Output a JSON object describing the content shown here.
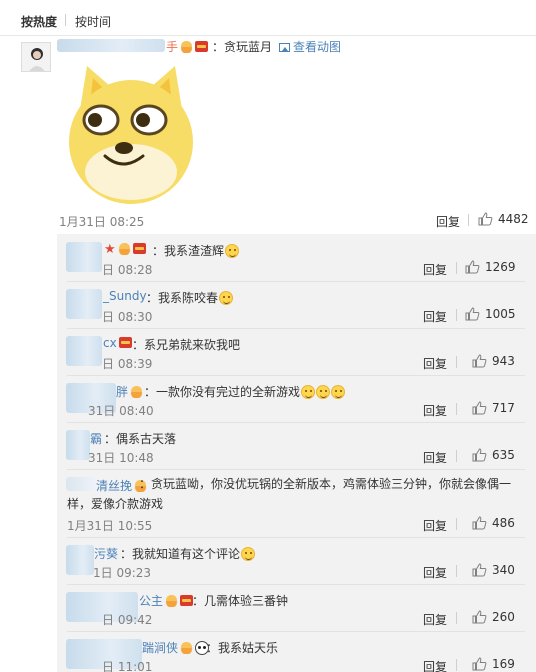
{
  "sort_tabs": [
    "按热度",
    "按时间"
  ],
  "main_comment": {
    "name_tail": "手",
    "text": "：贪玩蓝月",
    "view_pic": "查看动图",
    "time": "1月31日 08:25",
    "reply_label": "回复",
    "likes": "4482"
  },
  "replies": [
    {
      "name_tail": "",
      "text": "：我系渣渣辉",
      "time": "日 08:28",
      "likes": "1269"
    },
    {
      "name_tail": "_Sundy",
      "text": "：我系陈咬春",
      "time": "日 08:30",
      "likes": "1005"
    },
    {
      "name_tail": "cx",
      "text": "：系兄弟就来砍我吧",
      "time": "日 08:39",
      "likes": "943"
    },
    {
      "name_tail": "胖",
      "text": "：一款你没有完过的全新游戏",
      "time": "31日 08:40",
      "likes": "717"
    },
    {
      "name_tail": "霸",
      "text": "：偶系古天落",
      "time": "31日 10:48",
      "likes": "635"
    },
    {
      "name_tail": "清丝挽",
      "text_line1": "：贪玩蓝呦，你没优玩锅的全新版本，鸡需体验三分钟，你就会像偶一",
      "text_line2": "样，爱像介款游戏",
      "time": "1月31日 10:55",
      "likes": "486"
    },
    {
      "name_tail": "污葵",
      "text": "：我就知道有这个评论",
      "time": "1日 09:23",
      "likes": "340"
    },
    {
      "name_tail": "公主",
      "text": "：几需体验三番钟",
      "time": "日 09:42",
      "likes": "260"
    },
    {
      "name_tail": "踹涧侠",
      "text": "：我系姑天乐",
      "time": "日 11:01",
      "likes": "169"
    }
  ],
  "reply_label": "回复",
  "colors": {
    "link": "#4c82b8",
    "name": "#eb7350",
    "reply_bg": "#f2f2f2"
  },
  "icons": [
    "thumb-up-icon",
    "red-envelope-icon",
    "emoji-face-icon",
    "picture-icon"
  ]
}
